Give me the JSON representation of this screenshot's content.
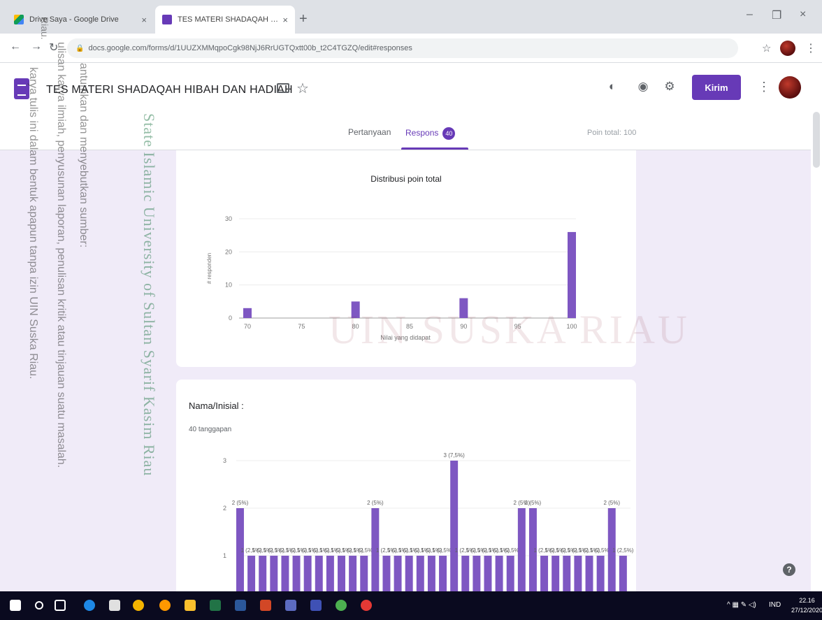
{
  "browser": {
    "tab1_title": "Drive Saya - Google Drive",
    "tab2_title": "TES MATERI SHADAQAH HIBAH DAN HADIAH",
    "tab_close": "×",
    "new_tab": "+",
    "url": "docs.google.com/forms/d/1UUZXMMqpoCgk98NjJ6RrUGTQxtt00b_t2C4TGZQ/edit#responses",
    "win_minimize": "–",
    "win_restore": "❐",
    "win_close": "×"
  },
  "form": {
    "title": "TES MATERI SHADAQAH HIBAH DAN HADIAH",
    "send_label": "Kirim",
    "tab_questions": "Pertanyaan",
    "tab_responses": "Respons",
    "responses_count": "40",
    "points_total": "Poin total: 100"
  },
  "card1": {
    "title": "Distribusi poin total"
  },
  "card2": {
    "question": "Nama/Inisial :",
    "count_label": "40 tanggapan"
  },
  "chart_data": [
    {
      "type": "bar",
      "title": "Distribusi poin total",
      "xlabel": "Nilai yang didapat",
      "ylabel": "# responden",
      "x": [
        70,
        80,
        90,
        100
      ],
      "values": [
        3,
        5,
        6,
        26
      ],
      "xticks": [
        "70",
        "75",
        "80",
        "85",
        "90",
        "95",
        "100"
      ],
      "yticks": [
        "0",
        "10",
        "20",
        "30"
      ],
      "xlim": [
        70,
        100
      ],
      "ylim": [
        0,
        30
      ],
      "color": "#7e57c2",
      "grid": true
    },
    {
      "type": "bar",
      "title": "Nama/Inisial :",
      "subtitle": "40 tanggapan",
      "values": [
        2,
        1,
        1,
        1,
        1,
        1,
        1,
        1,
        1,
        1,
        1,
        1,
        2,
        1,
        1,
        1,
        1,
        1,
        1,
        3,
        1,
        1,
        1,
        1,
        1,
        2,
        2,
        1,
        1,
        1,
        1,
        1,
        1,
        2,
        1
      ],
      "data_labels": [
        "2 (5%)",
        "1 (2,5%)",
        "1 (2,5%)",
        "1 (2,5%)",
        "1 (2,5%)",
        "1 (2,5%)",
        "1 (2,5%)",
        "1 (2,5%)",
        "1 (2,5%)",
        "1 (2,5%)",
        "1 (2,5%)",
        "1 (2,5%)",
        "2 (5%)",
        "1 (2,5%)",
        "1 (2,5%)",
        "1 (2,5%)",
        "1 (2,5%)",
        "1 (2,5%)",
        "1 (2,5%)",
        "3 (7,5%)",
        "1 (2,5%)",
        "1 (2,5%)",
        "1 (2,5%)",
        "1 (2,5%)",
        "1 (2,5%)",
        "2 (5%)",
        "2 (5%)",
        "1 (2,5%)",
        "1 (2,5%)",
        "1 (2,5%)",
        "1 (2,5%)",
        "1 (2,5%)",
        "1 (2,5%)",
        "2 (5%)",
        "1 (2,5%)"
      ],
      "yticks": [
        "1",
        "2",
        "3"
      ],
      "ylim": [
        0,
        3
      ],
      "color": "#7e57c2",
      "grid": true
    }
  ],
  "watermark": {
    "line1": "Riau.",
    "line2": "antumkan dan menyebutkan sumber:",
    "line3": "ulisan karya ilmiah, penyusunan laporan, penulisan kritik atau tinjauan suatu masalah.",
    "line4": "karya tulis ini dalam bentuk apapun tanpa izin UIN Suska Riau.",
    "university": "State Islamic University of Sultan Syarif Kasim Riau",
    "campus": "UIN SUSKA RIAU"
  },
  "taskbar": {
    "lang": "IND",
    "time": "22.16",
    "date": "27/12/2020"
  },
  "icons": [
    "drive-icon",
    "forms-icon",
    "folder-icon",
    "star-icon",
    "palette-icon",
    "eye-icon",
    "gear-icon",
    "more-icon",
    "help-icon"
  ]
}
